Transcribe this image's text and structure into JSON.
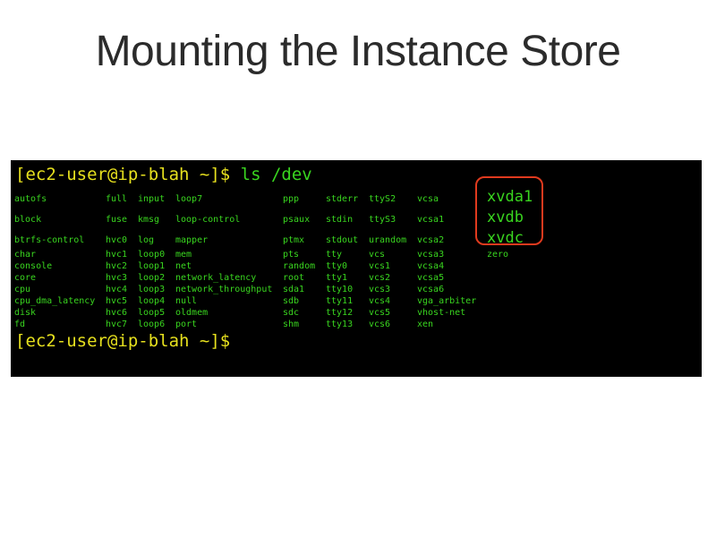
{
  "title": "Mounting the Instance Store",
  "terminal": {
    "prompt_host": "[ec2-user@ip-blah ~]$ ",
    "command": "ls /dev",
    "prompt_end": "[ec2-user@ip-blah ~]$"
  },
  "listing": {
    "col1": [
      "autofs",
      "block",
      "btrfs-control",
      "char",
      "console",
      "core",
      "cpu",
      "cpu_dma_latency",
      "disk",
      "fd"
    ],
    "col2": [
      "full",
      "fuse",
      "hvc0",
      "hvc1",
      "hvc2",
      "hvc3",
      "hvc4",
      "hvc5",
      "hvc6",
      "hvc7"
    ],
    "col3": [
      "input",
      "kmsg",
      "log",
      "loop0",
      "loop1",
      "loop2",
      "loop3",
      "loop4",
      "loop5",
      "loop6"
    ],
    "col4": [
      "loop7",
      "loop-control",
      "mapper",
      "mem",
      "net",
      "network_latency",
      "network_throughput",
      "null",
      "oldmem",
      "port"
    ],
    "col5": [
      "ppp",
      "psaux",
      "ptmx",
      "pts",
      "random",
      "root",
      "sda1",
      "sdb",
      "sdc",
      "shm"
    ],
    "col6": [
      "stderr",
      "stdin",
      "stdout",
      "tty",
      "tty0",
      "tty1",
      "tty10",
      "tty11",
      "tty12",
      "tty13"
    ],
    "col7": [
      "ttyS2",
      "ttyS3",
      "urandom",
      "vcs",
      "vcs1",
      "vcs2",
      "vcs3",
      "vcs4",
      "vcs5",
      "vcs6"
    ],
    "col8": [
      "vcsa",
      "vcsa1",
      "vcsa2",
      "vcsa3",
      "vcsa4",
      "vcsa5",
      "vcsa6",
      "vga_arbiter",
      "vhost-net",
      "xen"
    ],
    "col9_highlighted": [
      "xvda1",
      "xvdb",
      "xvdc"
    ],
    "col9_rest": [
      "zero"
    ]
  },
  "colors": {
    "prompt": "#e6e01e",
    "text": "#39d51f",
    "highlight_border": "#e03a1e",
    "terminal_bg": "#000000"
  }
}
